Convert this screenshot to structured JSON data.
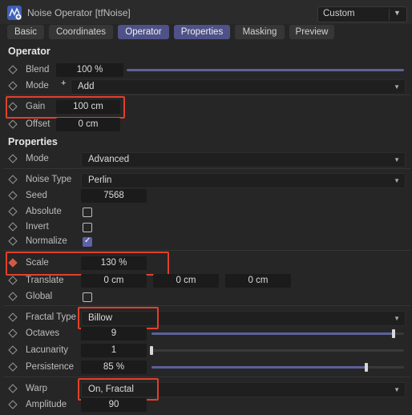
{
  "window": {
    "title": "Noise Operator [tfNoise]",
    "preset": "Custom"
  },
  "tabs": [
    {
      "label": "Basic",
      "active": false
    },
    {
      "label": "Coordinates",
      "active": false
    },
    {
      "label": "Operator",
      "active": true
    },
    {
      "label": "Properties",
      "active": true
    },
    {
      "label": "Masking",
      "active": false
    },
    {
      "label": "Preview",
      "active": false
    }
  ],
  "operator": {
    "heading": "Operator",
    "blend": {
      "label": "Blend",
      "value": "100 %",
      "fraction": 1.0
    },
    "mode": {
      "label": "Mode",
      "value": "Add"
    },
    "gain": {
      "label": "Gain",
      "value": "100 cm"
    },
    "offset": {
      "label": "Offset",
      "value": "0 cm"
    }
  },
  "properties": {
    "heading": "Properties",
    "mode": {
      "label": "Mode",
      "value": "Advanced"
    },
    "noise_type": {
      "label": "Noise Type",
      "value": "Perlin"
    },
    "seed": {
      "label": "Seed",
      "value": "7568"
    },
    "absolute": {
      "label": "Absolute",
      "checked": false
    },
    "invert": {
      "label": "Invert",
      "checked": false
    },
    "normalize": {
      "label": "Normalize",
      "checked": true
    },
    "scale": {
      "label": "Scale",
      "value": "130 %"
    },
    "translate": {
      "label": "Translate",
      "x": "0 cm",
      "y": "0 cm",
      "z": "0 cm"
    },
    "global": {
      "label": "Global",
      "checked": false
    },
    "fractal_type": {
      "label": "Fractal Type",
      "value": "Billow"
    },
    "octaves": {
      "label": "Octaves",
      "value": "9",
      "fraction": 0.96
    },
    "lacunarity": {
      "label": "Lacunarity",
      "value": "1",
      "fraction": 0.0
    },
    "persistence": {
      "label": "Persistence",
      "value": "85 %",
      "fraction": 0.85
    },
    "warp": {
      "label": "Warp",
      "value": "On, Fractal"
    },
    "amplitude": {
      "label": "Amplitude",
      "value": "90"
    }
  },
  "colors": {
    "accent": "#5d609a",
    "active_tab": "#4f5288",
    "highlight": "#e2402b",
    "keyframe_active": "#cf5a45"
  }
}
